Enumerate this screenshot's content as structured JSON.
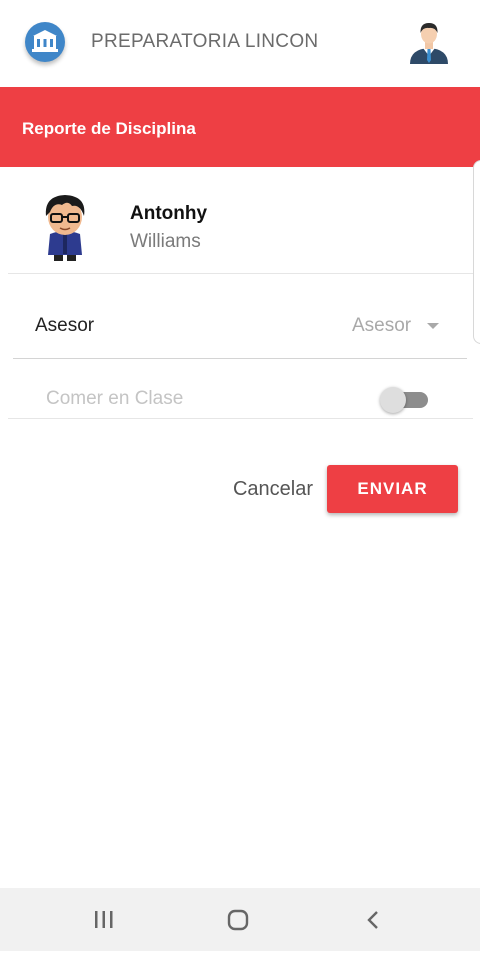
{
  "app": {
    "title": "PREPARATORIA LINCON",
    "logo_icon": "school-building-icon",
    "user_icon": "user-avatar-icon"
  },
  "header": {
    "title": "Reporte de Disciplina",
    "color": "#ee3f44"
  },
  "student": {
    "first_name": "Antonhy",
    "last_name": "Williams",
    "avatar_icon": "student-avatar-icon"
  },
  "form": {
    "asesor_label": "Asesor",
    "asesor_selected": "Asesor",
    "behavior_label": "Comer en Clase",
    "behavior_toggle_on": false
  },
  "actions": {
    "cancel_label": "Cancelar",
    "send_label": "ENVIAR"
  },
  "system_nav": {
    "recents_icon": "recents-icon",
    "home_icon": "home-icon",
    "back_icon": "back-icon"
  }
}
